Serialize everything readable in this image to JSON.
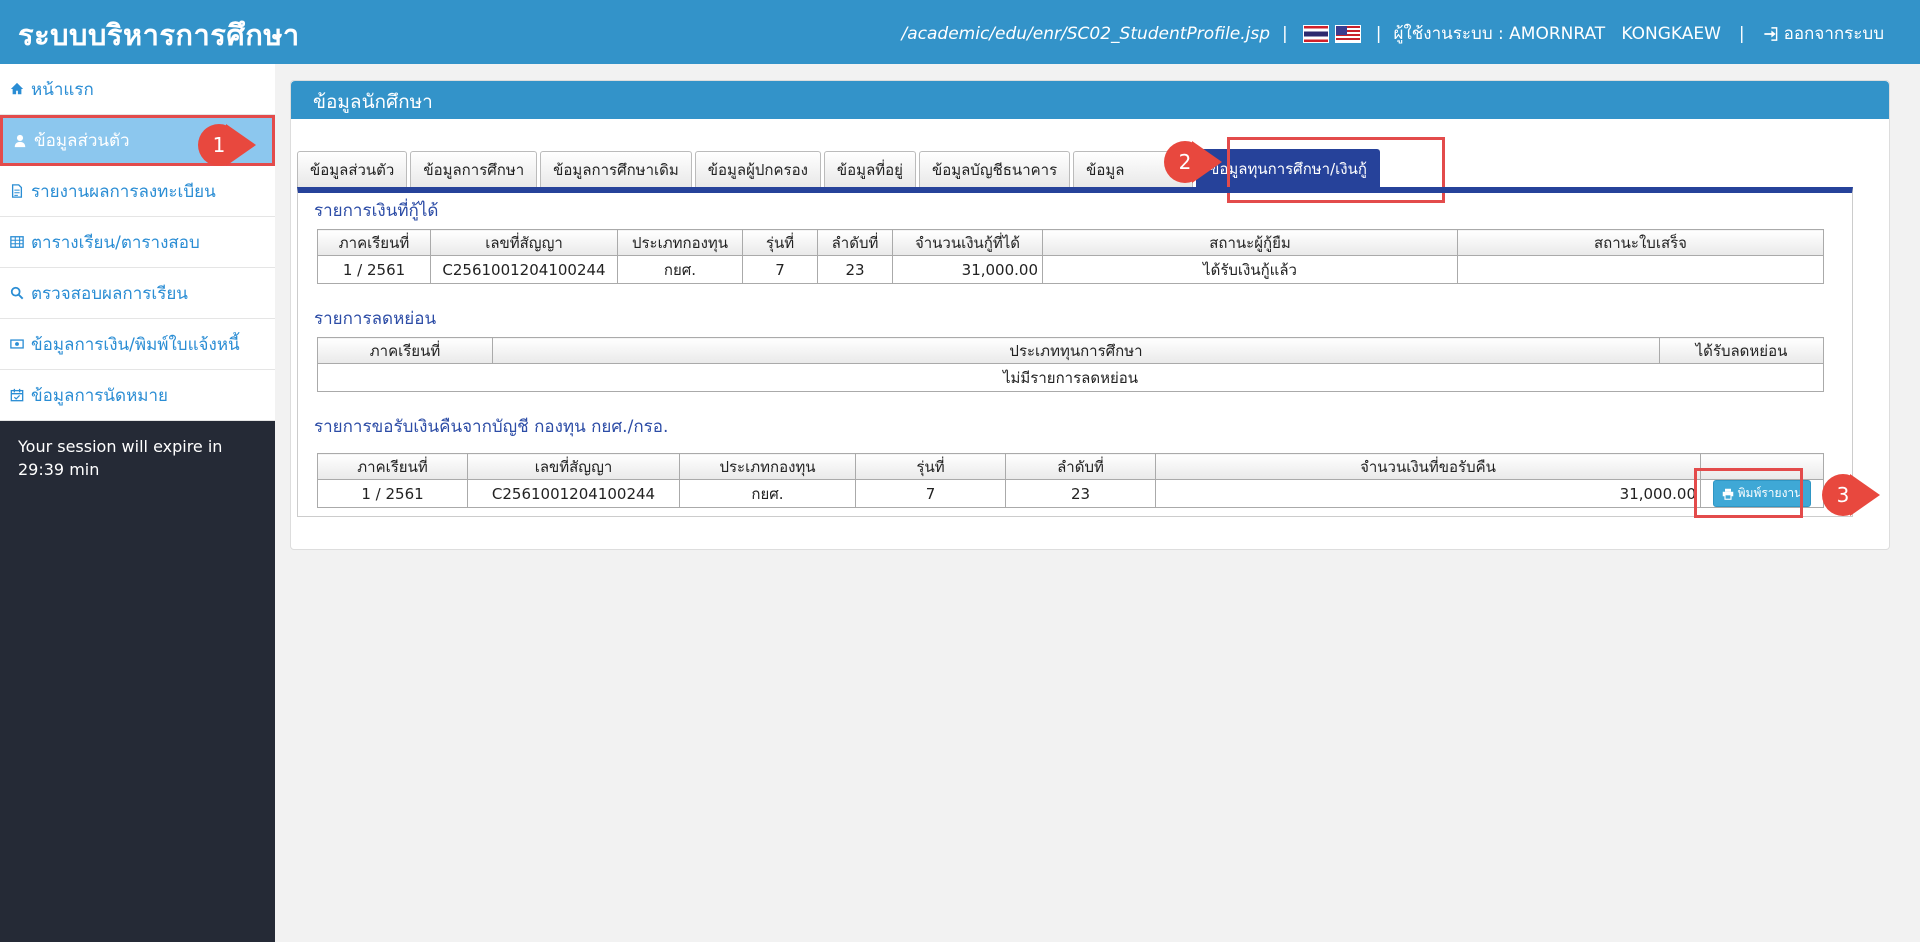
{
  "header": {
    "brand": "ระบบบริหารการศึกษา",
    "path": "/academic/edu/enr/SC02_StudentProfile.jsp",
    "sep1": "|",
    "sep2": "|",
    "sep3": "|",
    "user_label": "ผู้ใช้งานระบบ : AMORNRAT   KONGKAEW",
    "logout": "ออกจากระบบ"
  },
  "sidebar": {
    "items": [
      {
        "label": "หน้าแรก",
        "icon": "home-icon"
      },
      {
        "label": "ข้อมูลส่วนตัว",
        "icon": "user-icon"
      },
      {
        "label": "รายงานผลการลงทะเบียน",
        "icon": "document-icon"
      },
      {
        "label": "ตารางเรียน/ตารางสอบ",
        "icon": "table-icon"
      },
      {
        "label": "ตรวจสอบผลการเรียน",
        "icon": "search-icon"
      },
      {
        "label": "ข้อมูลการเงิน/พิมพ์ใบแจ้งหนี้",
        "icon": "money-icon"
      },
      {
        "label": "ข้อมูลการนัดหมาย",
        "icon": "calendar-icon"
      }
    ],
    "session_text": "Your session will expire in 29:39 min"
  },
  "callouts": [
    "1",
    "2",
    "3"
  ],
  "panel": {
    "title": "ข้อมูลนักศึกษา",
    "tabs": [
      "ข้อมูลส่วนตัว",
      "ข้อมูลการศึกษา",
      "ข้อมูลการศึกษาเดิม",
      "ข้อมูลผู้ปกครอง",
      "ข้อมูลที่อยู่",
      "ข้อมูลบัญชีธนาคาร",
      "ข้อมูล",
      "ข้อมูลทุนการศึกษา/เงินกู้"
    ],
    "active_tab": 7
  },
  "loans": {
    "title": "รายการเงินที่กู้ได้",
    "headers": [
      "ภาคเรียนที่",
      "เลขที่สัญญา",
      "ประเภทกองทุน",
      "รุ่นที่",
      "ลำดับที่",
      "จำนวนเงินกู้ที่ได้",
      "สถานะผู้กู้ยืม",
      "สถานะใบเสร็จ"
    ],
    "rows": [
      [
        "1 / 2561",
        "C2561001204100244",
        "กยศ.",
        "7",
        "23",
        "31,000.00",
        "ได้รับเงินกู้แล้ว",
        ""
      ]
    ]
  },
  "discounts": {
    "title": "รายการลดหย่อน",
    "headers": [
      "ภาคเรียนที่",
      "ประเภททุนการศึกษา",
      "ได้รับลดหย่อน"
    ],
    "empty_text": "ไม่มีรายการลดหย่อน"
  },
  "refunds": {
    "title": "รายการขอรับเงินคืนจากบัญชี กองทุน กยศ./กรอ.",
    "headers": [
      "ภาคเรียนที่",
      "เลขที่สัญญา",
      "ประเภทกองทุน",
      "รุ่นที่",
      "ลำดับที่",
      "จำนวนเงินที่ขอรับคืน",
      ""
    ],
    "rows": [
      [
        "1 / 2561",
        "C2561001204100244",
        "กยศ.",
        "7",
        "23",
        "31,000.00"
      ]
    ],
    "print_label": "พิมพ์รายงาน"
  },
  "colors": {
    "header_blue": "#3393c9",
    "tab_active": "#26429a",
    "callout_red": "#e8483e",
    "sidebar_dark": "#252a36"
  }
}
